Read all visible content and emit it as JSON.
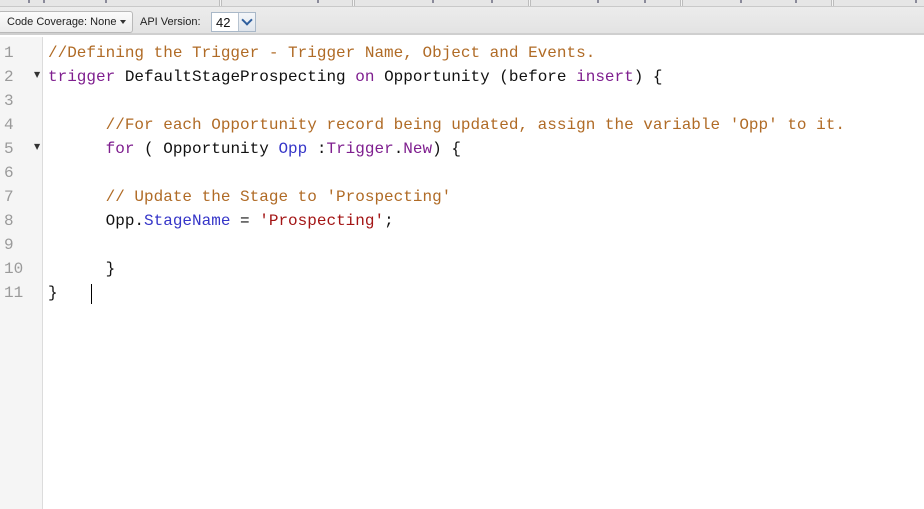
{
  "toolbar": {
    "coverage_label": "Code Coverage: None",
    "api_version_label": "API Version:",
    "api_version_value": "42"
  },
  "editor": {
    "lines": [
      {
        "num": "1",
        "fold": "",
        "indent": "",
        "tokens": [
          {
            "t": "comment",
            "v": "//Defining the Trigger - Trigger Name, Object and Events."
          }
        ]
      },
      {
        "num": "2",
        "fold": "▼",
        "indent": "",
        "tokens": [
          {
            "t": "kw",
            "v": "trigger"
          },
          {
            "t": "plain",
            "v": " DefaultStageProspecting "
          },
          {
            "t": "kw",
            "v": "on"
          },
          {
            "t": "plain",
            "v": " Opportunity (before "
          },
          {
            "t": "kw",
            "v": "insert"
          },
          {
            "t": "plain",
            "v": ") {"
          }
        ]
      },
      {
        "num": "3",
        "fold": "",
        "indent": "",
        "tokens": []
      },
      {
        "num": "4",
        "fold": "",
        "indent": "      ",
        "tokens": [
          {
            "t": "comment",
            "v": "//For each Opportunity record being updated, assign the variable 'Opp' to it."
          }
        ]
      },
      {
        "num": "5",
        "fold": "▼",
        "indent": "      ",
        "tokens": [
          {
            "t": "kw",
            "v": "for"
          },
          {
            "t": "plain",
            "v": " ( Opportunity "
          },
          {
            "t": "id",
            "v": "Opp"
          },
          {
            "t": "plain",
            "v": " :"
          },
          {
            "t": "kw",
            "v": "Trigger"
          },
          {
            "t": "plain",
            "v": "."
          },
          {
            "t": "kw",
            "v": "New"
          },
          {
            "t": "plain",
            "v": ") {"
          }
        ]
      },
      {
        "num": "6",
        "fold": "",
        "indent": "",
        "tokens": []
      },
      {
        "num": "7",
        "fold": "",
        "indent": "      ",
        "tokens": [
          {
            "t": "comment",
            "v": "// Update the Stage to 'Prospecting'"
          }
        ]
      },
      {
        "num": "8",
        "fold": "",
        "indent": "      ",
        "tokens": [
          {
            "t": "plain",
            "v": "Opp."
          },
          {
            "t": "id",
            "v": "StageName"
          },
          {
            "t": "plain",
            "v": " = "
          },
          {
            "t": "str",
            "v": "'Prospecting'"
          },
          {
            "t": "plain",
            "v": ";"
          }
        ]
      },
      {
        "num": "9",
        "fold": "",
        "indent": "",
        "tokens": []
      },
      {
        "num": "10",
        "fold": "",
        "indent": "      ",
        "tokens": [
          {
            "t": "plain",
            "v": "}"
          }
        ]
      },
      {
        "num": "11",
        "fold": "",
        "indent": "",
        "tokens": [
          {
            "t": "plain",
            "v": "}"
          }
        ]
      }
    ]
  }
}
